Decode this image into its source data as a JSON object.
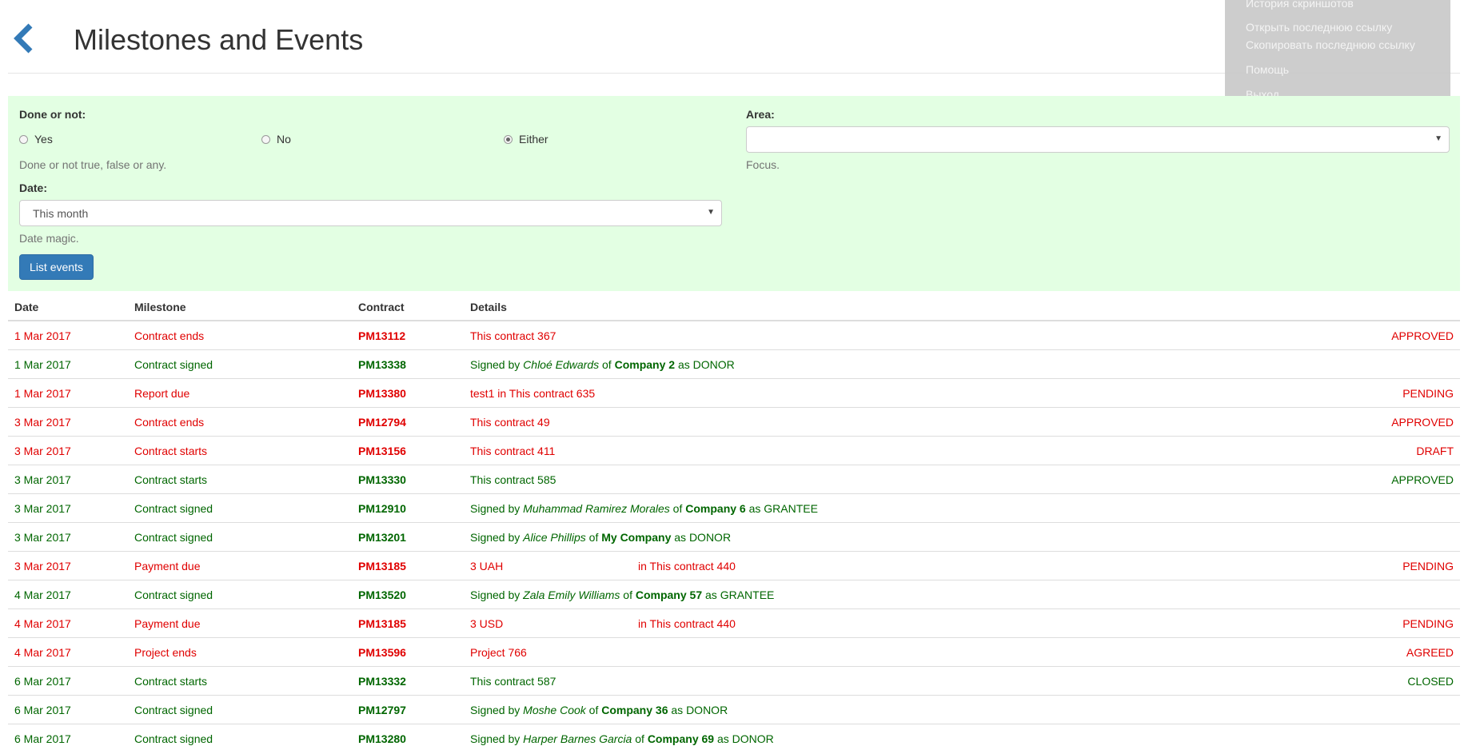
{
  "page": {
    "title": "Milestones and Events"
  },
  "overlay_menu": [
    "История скриншотов",
    "Открыть последнюю ссылку",
    "Скопировать последнюю ссылку",
    "Помощь",
    "Выход"
  ],
  "filters": {
    "done_label": "Done or not:",
    "done_options": [
      "Yes",
      "No",
      "Either"
    ],
    "done_selected": "Either",
    "done_help": "Done or not true, false or any.",
    "area_label": "Area:",
    "area_value": "",
    "area_help": "Focus.",
    "date_label": "Date:",
    "date_value": "This month",
    "date_help": "Date magic.",
    "submit_label": "List events"
  },
  "table": {
    "headers": [
      "Date",
      "Milestone",
      "Contract",
      "Details"
    ],
    "rows": [
      {
        "color": "red",
        "date": "1 Mar 2017",
        "milestone": "Contract ends",
        "contract": "PM13112",
        "details": "This contract 367",
        "status": "APPROVED"
      },
      {
        "color": "green",
        "date": "1 Mar 2017",
        "milestone": "Contract signed",
        "contract": "PM13338",
        "signed_person": "Chloé Edwards",
        "signed_company": "Company 2",
        "signed_role": "DONOR",
        "status": ""
      },
      {
        "color": "red",
        "date": "1 Mar 2017",
        "milestone": "Report due",
        "contract": "PM13380",
        "details": "test1 in This contract 635",
        "status": "PENDING"
      },
      {
        "color": "red",
        "date": "3 Mar 2017",
        "milestone": "Contract ends",
        "contract": "PM12794",
        "details": "This contract 49",
        "status": "APPROVED"
      },
      {
        "color": "red",
        "date": "3 Mar 2017",
        "milestone": "Contract starts",
        "contract": "PM13156",
        "details": "This contract 411",
        "status": "DRAFT"
      },
      {
        "color": "green",
        "date": "3 Mar 2017",
        "milestone": "Contract starts",
        "contract": "PM13330",
        "details": "This contract 585",
        "status": "APPROVED"
      },
      {
        "color": "green",
        "date": "3 Mar 2017",
        "milestone": "Contract signed",
        "contract": "PM12910",
        "signed_person": "Muhammad Ramirez Morales",
        "signed_company": "Company 6",
        "signed_role": "GRANTEE",
        "status": ""
      },
      {
        "color": "green",
        "date": "3 Mar 2017",
        "milestone": "Contract signed",
        "contract": "PM13201",
        "signed_person": "Alice Phillips",
        "signed_company": "My Company",
        "signed_role": "DONOR",
        "status": ""
      },
      {
        "color": "red",
        "date": "3 Mar 2017",
        "milestone": "Payment due",
        "contract": "PM13185",
        "amount": "3 UAH",
        "amount_ref": "in This contract 440",
        "status": "PENDING"
      },
      {
        "color": "green",
        "date": "4 Mar 2017",
        "milestone": "Contract signed",
        "contract": "PM13520",
        "signed_person": "Zala Emily Williams",
        "signed_company": "Company 57",
        "signed_role": "GRANTEE",
        "status": ""
      },
      {
        "color": "red",
        "date": "4 Mar 2017",
        "milestone": "Payment due",
        "contract": "PM13185",
        "amount": "3 USD",
        "amount_ref": "in This contract 440",
        "status": "PENDING"
      },
      {
        "color": "red",
        "date": "4 Mar 2017",
        "milestone": "Project ends",
        "contract": "PM13596",
        "details": "Project 766",
        "status": "AGREED"
      },
      {
        "color": "green",
        "date": "6 Mar 2017",
        "milestone": "Contract starts",
        "contract": "PM13332",
        "details": "This contract 587",
        "status": "CLOSED"
      },
      {
        "color": "green",
        "date": "6 Mar 2017",
        "milestone": "Contract signed",
        "contract": "PM12797",
        "signed_person": "Moshe Cook",
        "signed_company": "Company 36",
        "signed_role": "DONOR",
        "status": ""
      },
      {
        "color": "green",
        "date": "6 Mar 2017",
        "milestone": "Contract signed",
        "contract": "PM13280",
        "signed_person": "Harper Barnes Garcia",
        "signed_company": "Company 69",
        "signed_role": "DONOR",
        "status": ""
      }
    ]
  },
  "text": {
    "signed_by": "Signed by",
    "of": "of",
    "as": "as"
  },
  "colors": {
    "red": "#e00000",
    "green": "#006600",
    "filter_bg": "#e3ffe3",
    "primary": "#337ab7"
  },
  "icons": {
    "back": "chevron-left-icon"
  }
}
